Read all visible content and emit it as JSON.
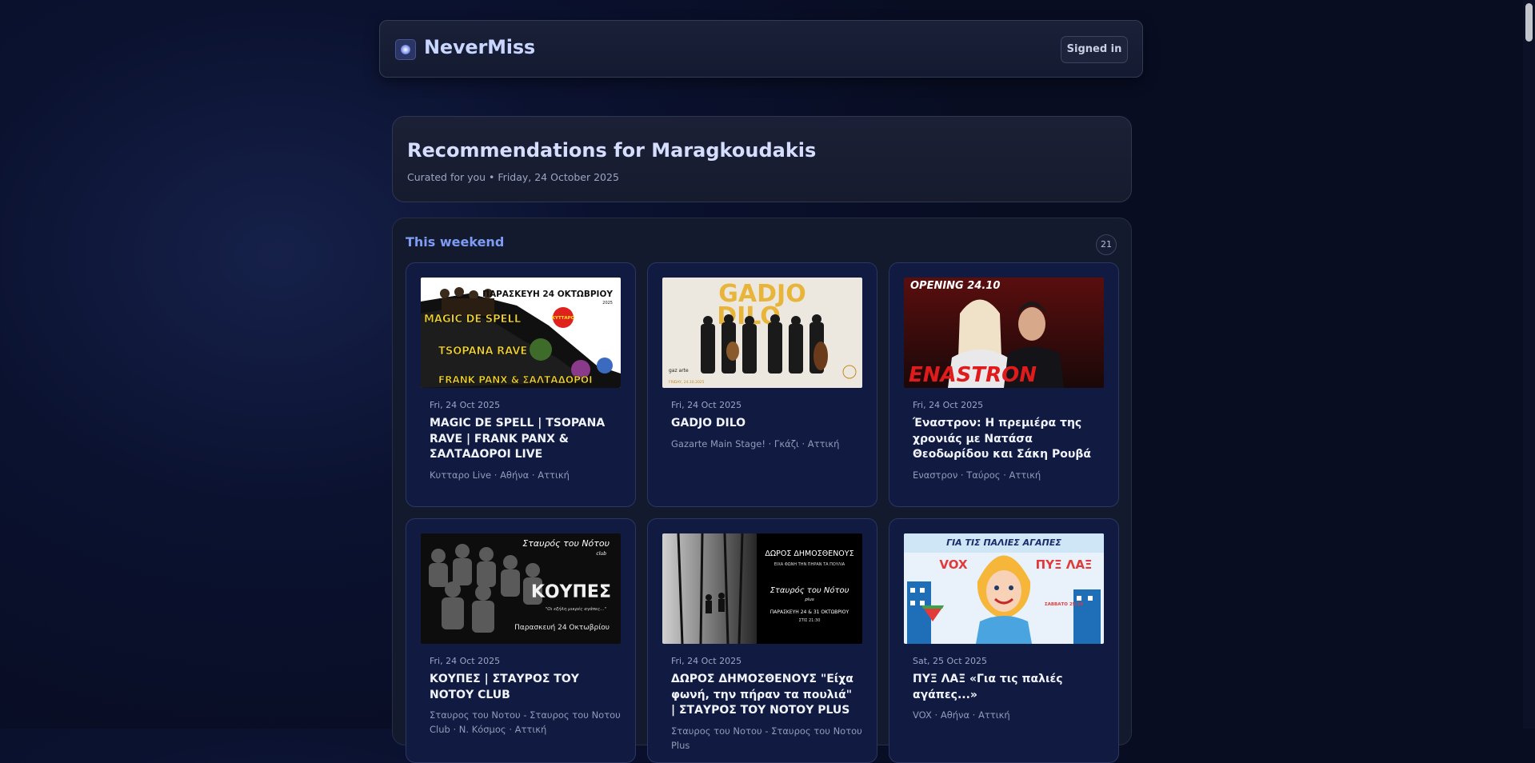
{
  "header": {
    "brand": "NeverMiss",
    "signed_in_label": "Signed in"
  },
  "hero": {
    "title": "Recommendations for Maragkoudakis",
    "subtitle": "Curated for you • Friday, 24 October 2025"
  },
  "section": {
    "title": "This weekend",
    "count": "21"
  },
  "events": [
    {
      "date": "Fri, 24 Oct 2025",
      "title": "MAGIC DE SPELL | TSOPANA RAVE | FRANK PANX & ΣΑΛΤΑΔΟΡΟΙ LIVE",
      "venue": "Κυτταρο Live · Αθήνα · Αττική",
      "poster": [
        "ΠΑΡΑΣΚΕΥΗ 24 ΟΚΤΩΒΡΙΟΥ",
        "2025",
        "MAGIC DE SPELL",
        "ΚΥΤΤΑΡΟ",
        "TSOPANA RAVE",
        "FRANK PANX & ΣΑΛΤΑΔΟΡΟΙ"
      ]
    },
    {
      "date": "Fri, 24 Oct 2025",
      "title": "GADJO DILO",
      "venue": "Gazarte Main Stage! · Γκάζι · Αττική",
      "poster": [
        "GADJO",
        "DILO",
        "gaz arte",
        "FRIDAY, 24.10.2025"
      ]
    },
    {
      "date": "Fri, 24 Oct 2025",
      "title": "Έναστρον: Η πρεμιέρα της χρονιάς με Νατάσα Θεοδωρίδου και Σάκη Ρουβά",
      "venue": "Εναστρον · Ταύρος · Αττική",
      "poster": [
        "OPENING 24.10",
        "ENASTRON"
      ]
    },
    {
      "date": "Fri, 24 Oct 2025",
      "title": "ΚΟΥΠΕΣ | ΣΤΑΥΡΟΣ ΤΟΥ ΝΟΤΟΥ CLUB",
      "venue": "Σταυρος του Νοτου - Σταυρος του Νοτου Club · Ν. Κόσμος · Αττική",
      "poster": [
        "Σταυρός του Νότου",
        "club",
        "ΚΟΥΠΕΣ",
        "\"Οι εξήλη μικρές αγάπες...\"",
        "Παρασκευή 24 Οκτωβρίου"
      ]
    },
    {
      "date": "Fri, 24 Oct 2025",
      "title": "ΔΩΡΟΣ ΔΗΜΟΣΘΕΝΟΥΣ \"Είχα φωνή, την πήραν τα πουλιά\" | ΣΤΑΥΡΟΣ ΤΟΥ ΝΟΤΟΥ PLUS",
      "venue": "Σταυρος του Νοτου - Σταυρος του Νοτου Plus",
      "poster": [
        "ΔΩΡΟΣ ΔΗΜΟΣΘΕΝΟΥΣ",
        "ΕΙΧΑ ΦΩΝΗ ΤΗΝ ΠΗΡΑΝ ΤΑ ΠΟΥΛΙΑ",
        "Σταυρός του Νότου",
        "plus",
        "ΠΑΡΑΣΚΕΥΗ 24 & 31 ΟΚΤΩΒΡΙΟΥ",
        "ΣΤΙΣ 21:30"
      ]
    },
    {
      "date": "Sat, 25 Oct 2025",
      "title": "ΠΥΞ ΛΑΞ «Για τις παλιές αγάπες...»",
      "venue": "VOX · Αθήνα · Αττική",
      "poster": [
        "ΓΙΑ ΤΙΣ ΠΑΛΙΕΣ ΑΓΑΠΕΣ",
        "VOX",
        "ΠΥΞ ΛΑΞ",
        "ΣΑΒΒΑΤΟ 25/10"
      ]
    }
  ]
}
